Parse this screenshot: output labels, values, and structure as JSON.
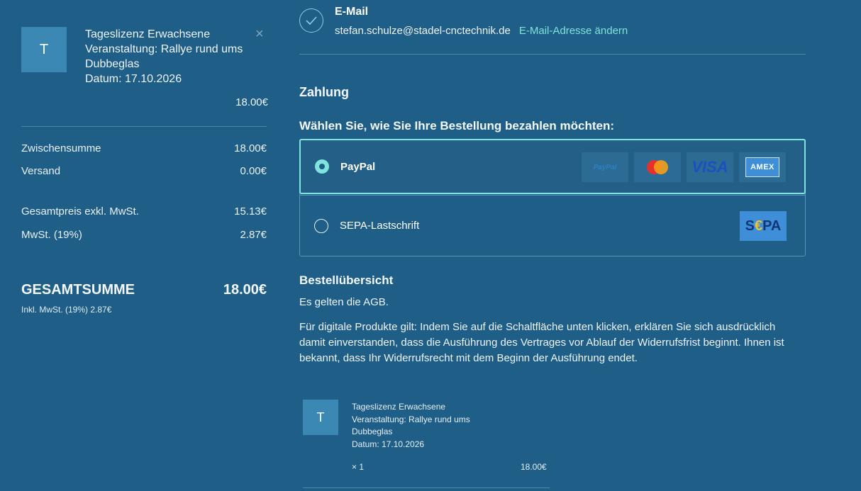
{
  "cart": {
    "avatar_letter": "T",
    "item_lines": [
      "Tageslizenz Erwachsene",
      "Veranstaltung: Rallye rund ums",
      "Dubbeglas",
      "Datum: 17.10.2026"
    ],
    "close_symbol": "×",
    "item_price": "18.00€"
  },
  "summary": {
    "subtotal_label": "Zwischensumme",
    "subtotal_value": "18.00€",
    "shipping_label": "Versand",
    "shipping_value": "0.00€",
    "net_label": "Gesamtpreis exkl. MwSt.",
    "net_value": "15.13€",
    "vat_label": "MwSt. (19%)",
    "vat_value": "2.87€",
    "total_label": "GESAMTSUMME",
    "total_value": "18.00€",
    "total_note": "Inkl. MwSt. (19%) 2.87€"
  },
  "email": {
    "title": "E-Mail",
    "address": "stefan.schulze@stadel-cnctechnik.de",
    "change_link": "E-Mail-Adresse ändern"
  },
  "payment": {
    "heading": "Zahlung",
    "question": "Wählen Sie, wie Sie Ihre Bestellung bezahlen möchten:",
    "options": [
      {
        "label": "PayPal",
        "selected": true
      },
      {
        "label": "SEPA-Lastschrift",
        "selected": false
      }
    ],
    "logos": {
      "paypal": "PayPal",
      "visa": "VISA",
      "amex": "AMEX",
      "sepa_s": "S",
      "sepa_e": "€",
      "sepa_pa": "PA"
    }
  },
  "overview": {
    "heading": "Bestellübersicht",
    "agb": "Es gelten die AGB.",
    "legal": "Für digitale Produkte gilt: Indem Sie auf die Schaltfläche unten klicken, erklären Sie sich ausdrücklich damit einverstanden, dass die Ausführung des Vertrages vor Ablauf der Widerrufsfrist beginnt. Ihnen ist bekannt, dass Ihr Widerrufsrecht mit dem Beginn der Ausführung endet.",
    "item": {
      "avatar_letter": "T",
      "lines": [
        "Tageslizenz Erwachsene",
        "Veranstaltung: Rallye rund ums",
        "Dubbeglas",
        "Datum: 17.10.2026"
      ],
      "qty": "× 1",
      "price": "18.00€"
    }
  },
  "colors": {
    "background": "#1f5e86",
    "accent": "#7fe4de",
    "link": "#7ee3dc"
  }
}
